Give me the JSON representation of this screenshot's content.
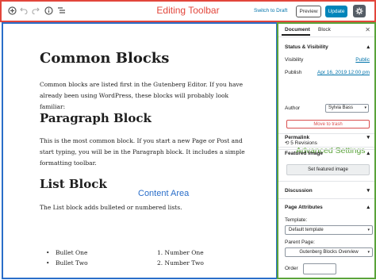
{
  "toolbar": {
    "title": "Editing Toolbar",
    "icons": [
      "add-block-icon",
      "undo-icon",
      "redo-icon",
      "info-icon",
      "block-navigation-icon",
      "settings-gear-icon"
    ],
    "switch_to_draft": "Switch to Draft",
    "preview": "Preview",
    "update": "Update",
    "accent_color": "#0085ba",
    "title_color": "#e2463b"
  },
  "content": {
    "area_label": "Content Area",
    "title": "Common Blocks",
    "intro": "Common blocks are listed first in the Gutenberg Editor. If you have already been using WordPress, these blocks will probably look familiar:",
    "paragraph_heading": "Paragraph Block",
    "paragraph_text": "This is the most common block. If you start a new Page or Post and start typing, you will be in the Paragraph block. It includes a simple formatting toolbar.",
    "list_heading": "List Block",
    "list_text": "The List block adds bulleted or numbered lists.",
    "bullets": [
      "Bullet One",
      "Bullet Two"
    ],
    "numbered": [
      "1. Number One",
      "2. Number Two"
    ],
    "border_color": "#2a6ec9"
  },
  "sidebar": {
    "tabs": [
      "Document",
      "Block"
    ],
    "active_tab": "Document",
    "label": "Advanced Settings",
    "status_heading": "Status & Visibility",
    "visibility_label": "Visibility",
    "visibility_value": "Public",
    "publish_label": "Publish",
    "publish_value": "Apr 16, 2019 12:00 pm",
    "author_label": "Author",
    "author_value": "Sylvia Bass",
    "trash": "Move to trash",
    "revisions": "5 Revisions",
    "permalink": "Permalink",
    "featured_image": "Featured Image",
    "set_featured": "Set featured image",
    "discussion": "Discussion",
    "page_attributes": "Page Attributes",
    "template_label": "Template:",
    "template_value": "Default template",
    "parent_label": "Parent Page:",
    "parent_value": "Gutenberg Blocks Overview",
    "order_label": "Order",
    "border_color": "#5aa33a",
    "danger_color": "#d94f4f"
  }
}
